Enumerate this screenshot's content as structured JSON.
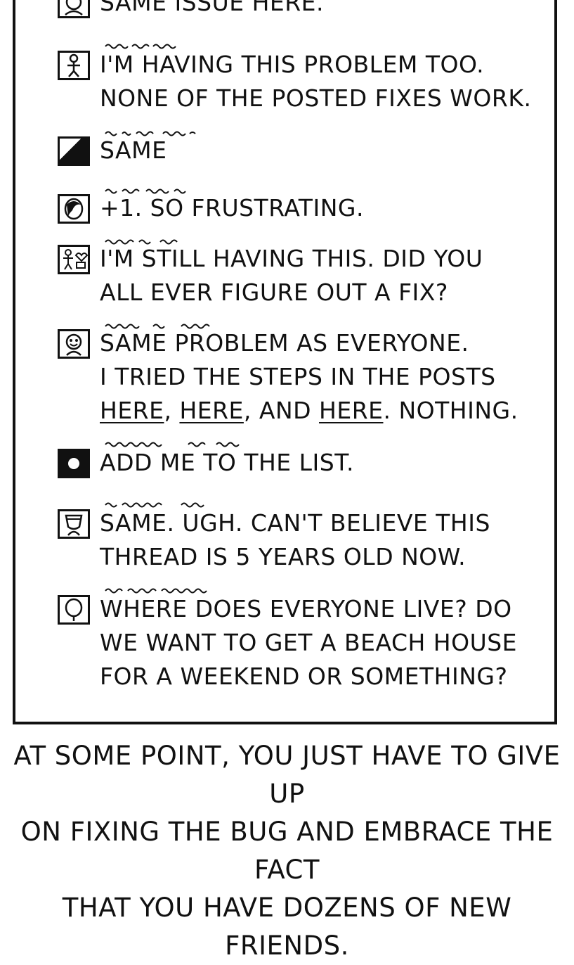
{
  "posts": [
    {
      "text": "SAME ISSUE HERE."
    },
    {
      "text": "I'M HAVING THIS PROBLEM TOO.\nNONE OF THE POSTED FIXES WORK."
    },
    {
      "text": "SAME"
    },
    {
      "text": "+1. SO FRUSTRATING."
    },
    {
      "text": "I'M STILL HAVING THIS. DID YOU\nALL EVER FIGURE OUT A FIX?"
    },
    {
      "line1": "SAME PROBLEM AS EVERYONE.",
      "line2": "I TRIED THE STEPS IN THE POSTS",
      "link1": "HERE",
      "sep1": ", ",
      "link2": "HERE",
      "sep2": ", AND ",
      "link3": "HERE",
      "tail": ". NOTHING."
    },
    {
      "text": "ADD ME TO THE LIST."
    },
    {
      "text": "SAME. UGH. CAN'T BELIEVE THIS\nTHREAD IS 5 YEARS OLD NOW."
    },
    {
      "text": "WHERE DOES EVERYONE LIVE? DO\nWE WANT TO GET A BEACH HOUSE\nFOR A WEEKEND OR SOMETHING?"
    }
  ],
  "caption": "AT SOME POINT, YOU JUST HAVE TO GIVE UP\nON FIXING THE BUG AND EMBRACE THE FACT\nTHAT YOU HAVE DOZENS OF NEW FRIENDS.",
  "icons": [
    "user-avatar-icon",
    "stick-figure-avatar-icon",
    "diagonal-avatar-icon",
    "hooded-face-avatar-icon",
    "group-avatar-icon",
    "gremlin-avatar-icon",
    "dot-avatar-icon",
    "cup-face-avatar-icon",
    "blank-face-avatar-icon"
  ],
  "colors": {
    "ink": "#111111",
    "paper": "#ffffff"
  }
}
